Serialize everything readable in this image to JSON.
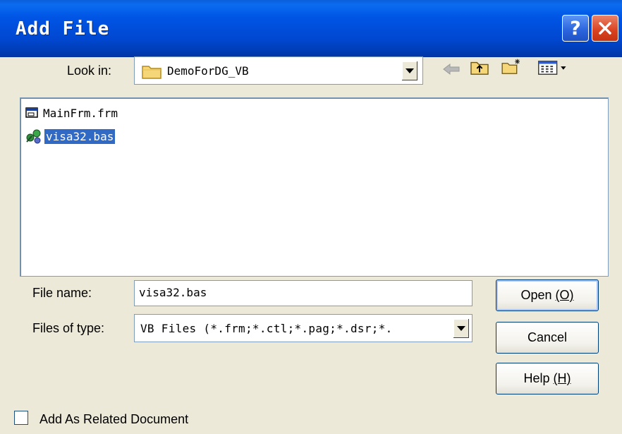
{
  "window": {
    "title": "Add File",
    "help_button": "?"
  },
  "look_in": {
    "label": "Look in:",
    "value": "DemoForDG_VB"
  },
  "files": [
    {
      "name": "MainFrm.frm",
      "icon": "form-file-icon",
      "selected": false
    },
    {
      "name": "visa32.bas",
      "icon": "module-file-icon",
      "selected": true
    }
  ],
  "file_name": {
    "label": "File name:",
    "value": "visa32.bas"
  },
  "file_type": {
    "label": "Files of type:",
    "value": "VB Files (*.frm;*.ctl;*.pag;*.dsr;*."
  },
  "buttons": {
    "open": "Open",
    "open_key": "(O)",
    "cancel": "Cancel",
    "help": "Help",
    "help_key": "(H)"
  },
  "related": {
    "label": "Add As Related Document",
    "checked": false
  },
  "colors": {
    "titlebar": "#0055e5",
    "selection": "#316ac5",
    "dialog_bg": "#ECE9D8"
  }
}
